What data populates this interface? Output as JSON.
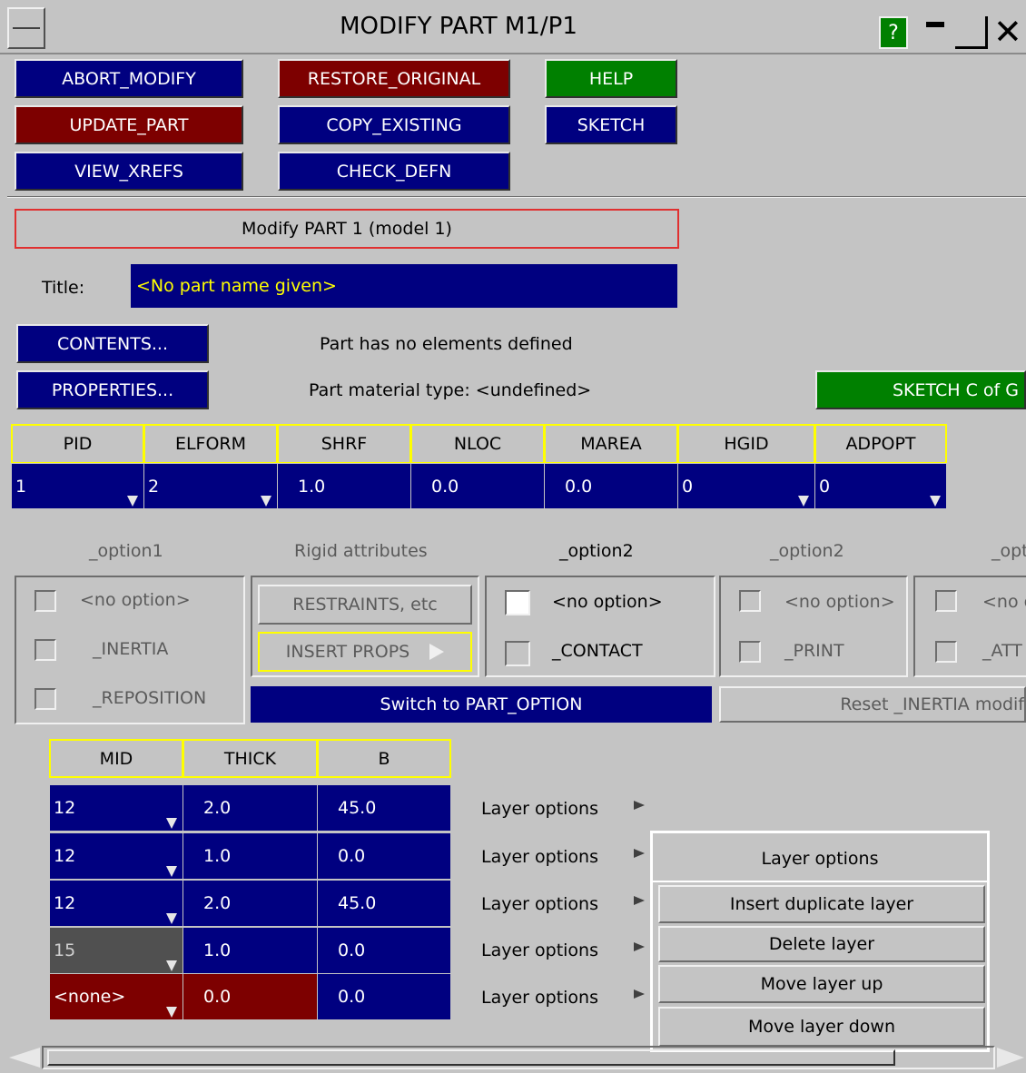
{
  "window": {
    "title": "MODIFY PART M1/P1",
    "help_char": "?"
  },
  "buttons": {
    "abort": "ABORT_MODIFY",
    "restore": "RESTORE_ORIGINAL",
    "help": "HELP",
    "update": "UPDATE_PART",
    "copy": "COPY_EXISTING",
    "sketch": "SKETCH",
    "view_xrefs": "VIEW_XREFS",
    "check_defn": "CHECK_DEFN"
  },
  "banner": "Modify PART 1 (model 1)",
  "title_field": {
    "label": "Title:",
    "value": "<No part name given>"
  },
  "contents": {
    "button": "CONTENTS...",
    "info": "Part has no elements defined"
  },
  "properties": {
    "button": "PROPERTIES...",
    "info": "Part material type: <undefined>"
  },
  "sketch_cog": "SKETCH C of G",
  "part_table": {
    "headers": [
      "PID",
      "ELFORM",
      "SHRF",
      "NLOC",
      "MAREA",
      "HGID",
      "ADPOPT"
    ],
    "values": [
      "1",
      "2",
      "1.0",
      "0.0",
      "0.0",
      "0",
      "0"
    ]
  },
  "options": {
    "option1_label": "_option1",
    "rigid_label": "Rigid attributes",
    "option2_label": "_option2",
    "option3_label": "_option2",
    "option4_label": "_opt",
    "option1_items": [
      "<no option>",
      "_INERTIA",
      "_REPOSITION"
    ],
    "rigid_buttons": [
      "RESTRAINTS, etc",
      "INSERT PROPS"
    ],
    "option2_items": [
      "<no option>",
      "_CONTACT"
    ],
    "option3_items": [
      "<no option>",
      "_PRINT"
    ],
    "option4_items": [
      "<no o",
      "_ATT"
    ],
    "switch_button": "Switch to PART_OPTION",
    "reset_button": "Reset _INERTIA modif"
  },
  "layer_table": {
    "headers": [
      "MID",
      "THICK",
      "B"
    ],
    "rows": [
      {
        "mid": "12",
        "thick": "2.0",
        "b": "45.0",
        "opt": "Layer options"
      },
      {
        "mid": "12",
        "thick": "1.0",
        "b": "0.0",
        "opt": "Layer options"
      },
      {
        "mid": "12",
        "thick": "2.0",
        "b": "45.0",
        "opt": "Layer options"
      },
      {
        "mid": "15",
        "thick": "1.0",
        "b": "0.0",
        "opt": "Layer options"
      },
      {
        "mid": "<none>",
        "thick": "0.0",
        "b": "0.0",
        "opt": "Layer options"
      }
    ]
  },
  "layer_menu": {
    "title": "Layer options",
    "items": [
      "Insert duplicate layer",
      "Delete layer",
      "Move layer up",
      "Move layer down"
    ]
  },
  "colors": {
    "navy": "#000080",
    "maroon": "#7d0000",
    "green": "#008000",
    "header_border": "#ffff00",
    "banner_border": "#e03030"
  }
}
